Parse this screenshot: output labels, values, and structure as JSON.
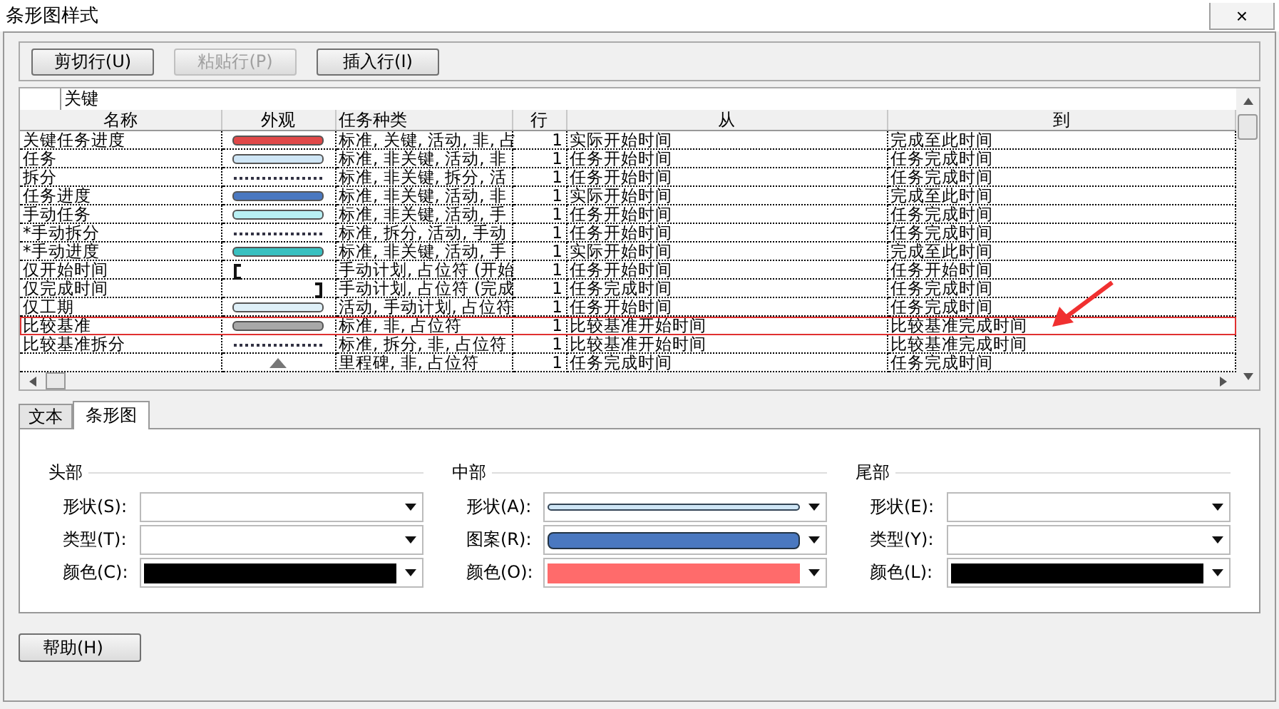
{
  "window": {
    "title": "条形图样式",
    "close": "×"
  },
  "toolbar": [
    {
      "label": "剪切行(U)",
      "disabled": false
    },
    {
      "label": "粘贴行(P)",
      "disabled": true
    },
    {
      "label": "插入行(I)",
      "disabled": false
    }
  ],
  "table": {
    "edit_value": "关键",
    "columns": [
      "名称",
      "外观",
      "任务种类",
      "行",
      "从",
      "到"
    ],
    "rows": [
      {
        "name": "关键任务进度",
        "appearance": {
          "kind": "bar",
          "color": "#e04848"
        },
        "type": "标准, 关键, 活动, 非, 占",
        "row": "1",
        "from": "实际开始时间",
        "to": "完成至此时间",
        "highlighted": false
      },
      {
        "name": "任务",
        "appearance": {
          "kind": "bar",
          "color": "#cfe6f6"
        },
        "type": "标准, 非关键, 活动, 非",
        "row": "1",
        "from": "任务开始时间",
        "to": "任务完成时间",
        "highlighted": false
      },
      {
        "name": "拆分",
        "appearance": {
          "kind": "dots"
        },
        "type": "标准, 非关键, 拆分, 活",
        "row": "1",
        "from": "任务开始时间",
        "to": "任务完成时间",
        "highlighted": false
      },
      {
        "name": "任务进度",
        "appearance": {
          "kind": "bar",
          "color": "#4a78c0"
        },
        "type": "标准, 非关键, 活动, 非",
        "row": "1",
        "from": "实际开始时间",
        "to": "完成至此时间",
        "highlighted": false
      },
      {
        "name": "手动任务",
        "appearance": {
          "kind": "bar",
          "color": "#b8f0f4"
        },
        "type": "标准, 非关键, 活动, 手",
        "row": "1",
        "from": "任务开始时间",
        "to": "任务完成时间",
        "highlighted": false
      },
      {
        "name": "*手动拆分",
        "appearance": {
          "kind": "dots"
        },
        "type": "标准, 拆分, 活动, 手动",
        "row": "1",
        "from": "任务开始时间",
        "to": "任务完成时间",
        "highlighted": false
      },
      {
        "name": "*手动进度",
        "appearance": {
          "kind": "bar",
          "color": "#38c0c0"
        },
        "type": "标准, 非关键, 活动, 手",
        "row": "1",
        "from": "实际开始时间",
        "to": "完成至此时间",
        "highlighted": false
      },
      {
        "name": "仅开始时间",
        "appearance": {
          "kind": "start-bracket"
        },
        "type": "手动计划, 占位符 (开始",
        "row": "1",
        "from": "任务开始时间",
        "to": "任务开始时间",
        "highlighted": false
      },
      {
        "name": "仅完成时间",
        "appearance": {
          "kind": "end-bracket"
        },
        "type": "手动计划, 占位符 (完成",
        "row": "1",
        "from": "任务完成时间",
        "to": "任务完成时间",
        "highlighted": false
      },
      {
        "name": "仅工期",
        "appearance": {
          "kind": "bar",
          "color": "#dff0f8"
        },
        "type": "活动, 手动计划, 占位符",
        "row": "1",
        "from": "任务开始时间",
        "to": "任务完成时间",
        "highlighted": false
      },
      {
        "name": "比较基准",
        "appearance": {
          "kind": "bar",
          "color": "#a8a8a8"
        },
        "type": "标准, 非, 占位符",
        "row": "1",
        "from": "比较基准开始时间",
        "to": "比较基准完成时间",
        "highlighted": true
      },
      {
        "name": "比较基准拆分",
        "appearance": {
          "kind": "dots"
        },
        "type": "标准, 拆分, 非, 占位符",
        "row": "1",
        "from": "比较基准开始时间",
        "to": "比较基准完成时间",
        "highlighted": false
      },
      {
        "name": "",
        "appearance": {
          "kind": "diamond"
        },
        "type": "里程碑, 非, 占位符",
        "row": "1",
        "from": "任务完成时间",
        "to": "任务完成时间",
        "highlighted": false
      }
    ]
  },
  "tabs": [
    {
      "label": "文本",
      "selected": false
    },
    {
      "label": "条形图",
      "selected": true
    }
  ],
  "groups": [
    {
      "title": "头部",
      "fields": [
        {
          "label": "形状(S):",
          "kind": "empty"
        },
        {
          "label": "类型(T):",
          "kind": "empty"
        },
        {
          "label": "颜色(C):",
          "kind": "color",
          "color": "#000000"
        }
      ]
    },
    {
      "title": "中部",
      "fields": [
        {
          "label": "形状(A):",
          "kind": "shape"
        },
        {
          "label": "图案(R):",
          "kind": "pattern",
          "color": "#4a78c0"
        },
        {
          "label": "颜色(O):",
          "kind": "color",
          "color": "#ff6b6b"
        }
      ]
    },
    {
      "title": "尾部",
      "fields": [
        {
          "label": "形状(E):",
          "kind": "empty"
        },
        {
          "label": "类型(Y):",
          "kind": "empty"
        },
        {
          "label": "颜色(L):",
          "kind": "color",
          "color": "#000000"
        }
      ]
    }
  ],
  "help_button": "帮助(H)"
}
